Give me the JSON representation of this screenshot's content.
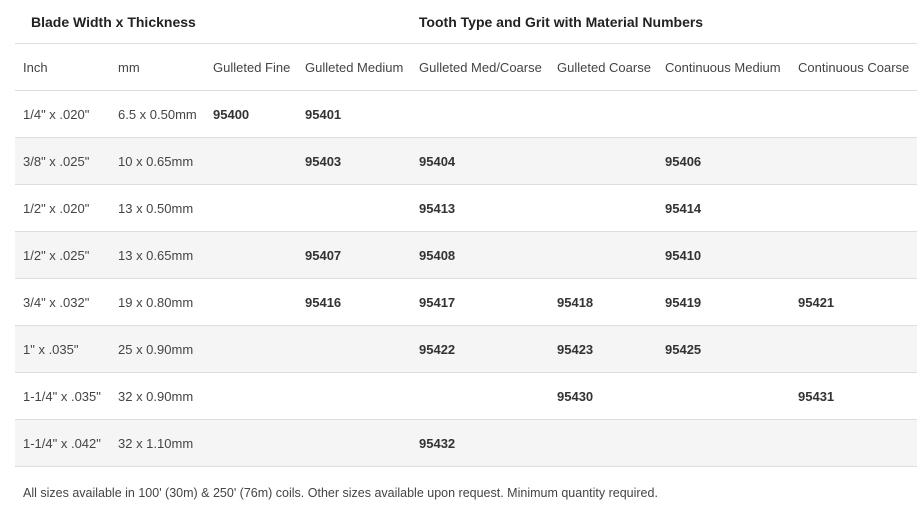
{
  "header": {
    "group_size": "Blade Width x Thickness",
    "group_tooth": "Tooth Type and Grit with Material Numbers"
  },
  "columns": [
    "Inch",
    "mm",
    "Gulleted Fine",
    "Gulleted Medium",
    "Gulleted Med/Coarse",
    "Gulleted Coarse",
    "Continuous Medium",
    "Continuous Coarse"
  ],
  "rows": [
    [
      "1/4\" x .020\"",
      "6.5 x 0.50mm",
      "95400",
      "95401",
      "",
      "",
      "",
      ""
    ],
    [
      "3/8\" x .025\"",
      "10 x 0.65mm",
      "",
      "95403",
      "95404",
      "",
      "95406",
      ""
    ],
    [
      "1/2\" x .020\"",
      "13 x 0.50mm",
      "",
      "",
      "95413",
      "",
      "95414",
      ""
    ],
    [
      "1/2\" x .025\"",
      "13 x 0.65mm",
      "",
      "95407",
      "95408",
      "",
      "95410",
      ""
    ],
    [
      "3/4\" x .032\"",
      "19 x 0.80mm",
      "",
      "95416",
      "95417",
      "95418",
      "95419",
      "95421"
    ],
    [
      "1\" x .035\"",
      "25 x 0.90mm",
      "",
      "",
      "95422",
      "95423",
      "95425",
      ""
    ],
    [
      "1-1/4\" x .035\"",
      "32 x 0.90mm",
      "",
      "",
      "",
      "95430",
      "",
      "95431"
    ],
    [
      "1-1/4\" x .042\"",
      "32 x 1.10mm",
      "",
      "",
      "95432",
      "",
      "",
      ""
    ]
  ],
  "footnote": "All sizes available in 100' (30m) & 250' (76m) coils. Other sizes available upon request. Minimum quantity required."
}
